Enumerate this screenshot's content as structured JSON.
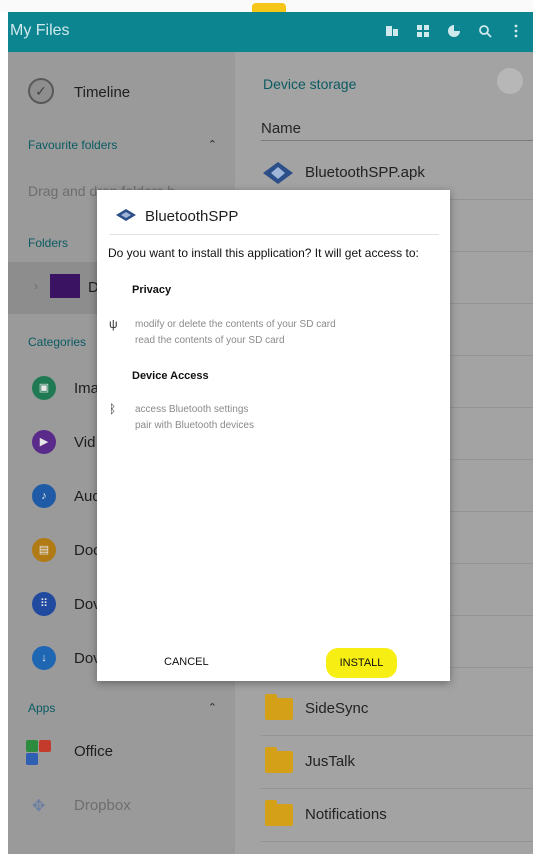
{
  "appbar": {
    "title": "My Files",
    "icons": [
      "storage-icon",
      "grid-icon",
      "pie-icon",
      "search-icon",
      "more-icon"
    ]
  },
  "sidebar": {
    "timeline": "Timeline",
    "favourite_folders": "Favourite folders",
    "drag_hint": "Drag and drop folders h",
    "folders": "Folders",
    "folder_item": "D",
    "categories": "Categories",
    "category_items": [
      {
        "label": "Ima",
        "icon": "images-icon",
        "color": "#1f7a54"
      },
      {
        "label": "Vid",
        "icon": "video-icon",
        "color": "#5a2a8a"
      },
      {
        "label": "Aud",
        "icon": "music-icon",
        "color": "#1f5aa6"
      },
      {
        "label": "Doc",
        "icon": "document-icon",
        "color": "#b07a15"
      },
      {
        "label": "Dov",
        "icon": "download-history-icon",
        "color": "#1f4aa0"
      },
      {
        "label": "Dov",
        "icon": "download-icon",
        "color": "#1f66b3"
      }
    ],
    "apps": "Apps",
    "office": "Office",
    "dropbox": "Dropbox"
  },
  "main": {
    "device_storage": "Device storage",
    "name_header": "Name",
    "files": [
      {
        "label": "BluetoothSPP.apk",
        "type": "apk"
      },
      {
        "label": "SideSync",
        "type": "folder"
      },
      {
        "label": "JusTalk",
        "type": "folder"
      },
      {
        "label": "Notifications",
        "type": "folder"
      }
    ]
  },
  "dialog": {
    "app_name": "BluetoothSPP",
    "question": "Do you want to install this application? It will get access to:",
    "sections": [
      {
        "heading": "Privacy",
        "icon": "usb-icon",
        "lines": [
          "modify or delete the contents of your SD card",
          "read the contents of your SD card"
        ]
      },
      {
        "heading": "Device Access",
        "icon": "bluetooth-icon",
        "lines": [
          "access Bluetooth settings",
          "pair with Bluetooth devices"
        ]
      }
    ],
    "cancel": "CANCEL",
    "install": "INSTALL"
  },
  "colors": {
    "appbar": "#0d8591",
    "accent_text": "#0b5b63",
    "install_highlight": "#f7ef13",
    "folder": "#d4a017"
  }
}
